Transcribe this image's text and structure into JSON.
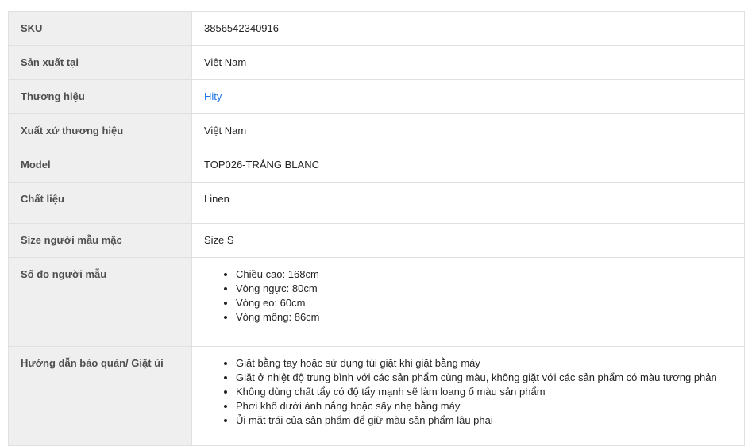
{
  "rows": [
    {
      "label": "SKU",
      "value": "3856542340916"
    },
    {
      "label": "Sản xuất tại",
      "value": "Việt Nam"
    },
    {
      "label": "Thương hiệu",
      "value": "Hity"
    },
    {
      "label": "Xuất xứ thương hiệu",
      "value": "Việt Nam"
    },
    {
      "label": "Model",
      "value": "TOP026-TRẮNG BLANC"
    },
    {
      "label": "Chất liệu",
      "value": "Linen"
    },
    {
      "label": "Size người mẫu mặc",
      "value": "Size S"
    },
    {
      "label": "Số đo người mẫu",
      "items": [
        "Chiều cao: 168cm",
        "Vòng ngực: 80cm",
        "Vòng eo: 60cm",
        "Vòng mông: 86cm"
      ]
    },
    {
      "label": "Hướng dẫn bảo quản/ Giặt ủi",
      "items": [
        "Giặt bằng tay hoặc sử dụng túi giặt khi giặt bằng máy",
        "Giặt ở nhiệt độ trung bình với các sản phẩm cùng màu, không giặt với các sản phẩm có màu tương phản",
        "Không dùng chất tẩy có độ tẩy mạnh sẽ làm loang ố màu sản phẩm",
        "Phơi khô dưới ánh nắng hoặc sấy nhẹ bằng máy",
        "Ủi mặt trái của sản phẩm để giữ màu sản phẩm lâu phai"
      ]
    }
  ],
  "colors": {
    "label_bg": "#efefef",
    "border": "#e0e0e0",
    "link": "#1a73e8"
  }
}
